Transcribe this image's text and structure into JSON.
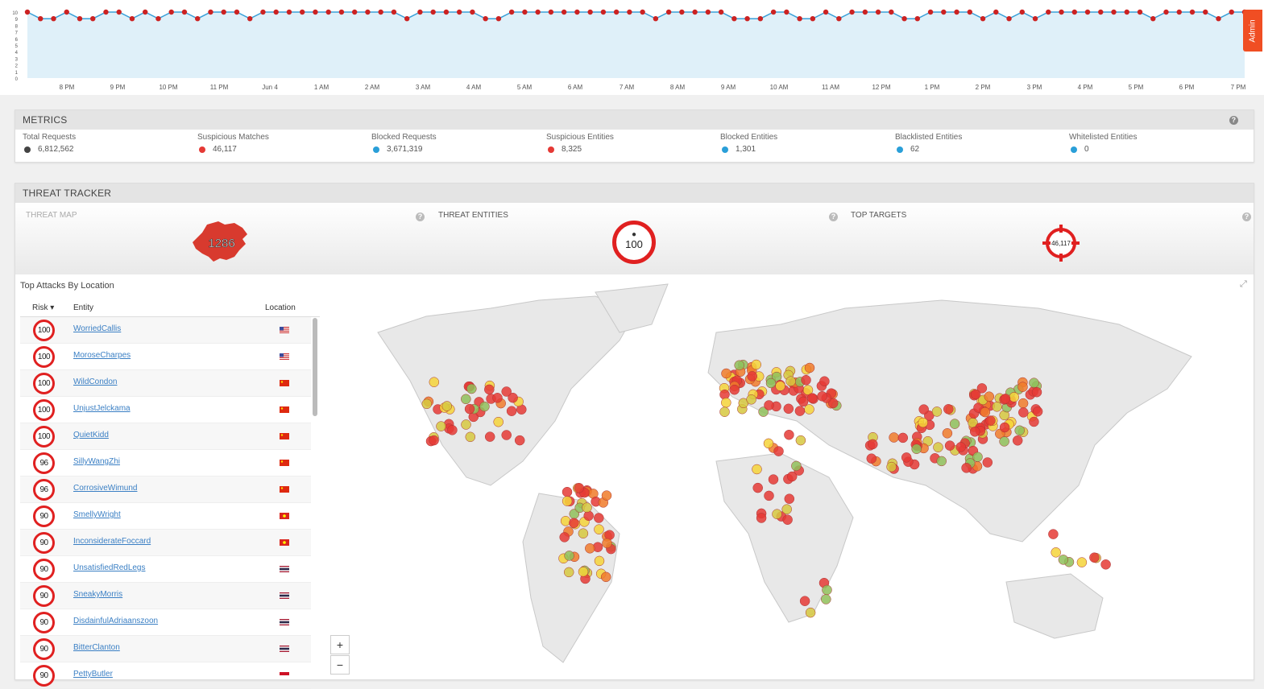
{
  "admin_tab": "Admin",
  "timeline": {
    "y_ticks": [
      "10",
      "9",
      "8",
      "7",
      "6",
      "5",
      "4",
      "3",
      "2",
      "1",
      "0"
    ],
    "x_ticks": [
      "8 PM",
      "9 PM",
      "10 PM",
      "11 PM",
      "Jun 4",
      "1 AM",
      "2 AM",
      "3 AM",
      "4 AM",
      "5 AM",
      "6 AM",
      "7 AM",
      "8 AM",
      "9 AM",
      "10 AM",
      "11 AM",
      "12 PM",
      "1 PM",
      "2 PM",
      "3 PM",
      "4 PM",
      "5 PM",
      "6 PM",
      "7 PM"
    ],
    "values": [
      10,
      9,
      9,
      10,
      9,
      9,
      10,
      10,
      9,
      10,
      9,
      10,
      10,
      9,
      10,
      10,
      10,
      9,
      10,
      10,
      10,
      10,
      10,
      10,
      10,
      10,
      10,
      10,
      10,
      9,
      10,
      10,
      10,
      10,
      10,
      9,
      9,
      10,
      10,
      10,
      10,
      10,
      10,
      10,
      10,
      10,
      10,
      10,
      9,
      10,
      10,
      10,
      10,
      10,
      9,
      9,
      9,
      10,
      10,
      9,
      9,
      10,
      9,
      10,
      10,
      10,
      10,
      9,
      9,
      10,
      10,
      10,
      10,
      9,
      10,
      9,
      10,
      9,
      10,
      10,
      10,
      10,
      10,
      10,
      10,
      10,
      9,
      10,
      10,
      10,
      10,
      9,
      10,
      10
    ],
    "colors": {
      "line": "#3aa0d8",
      "area": "#dff0f9",
      "dot": "#cc2222"
    }
  },
  "metrics": {
    "title": "METRICS",
    "items": [
      {
        "label": "Total Requests",
        "value": "6,812,562",
        "color": "#444444"
      },
      {
        "label": "Suspicious Matches",
        "value": "46,117",
        "color": "#e53935"
      },
      {
        "label": "Blocked Requests",
        "value": "3,671,319",
        "color": "#2a9fd8"
      },
      {
        "label": "Suspicious Entities",
        "value": "8,325",
        "color": "#e53935"
      },
      {
        "label": "Blocked Entities",
        "value": "1,301",
        "color": "#2a9fd8"
      },
      {
        "label": "Blacklisted Entities",
        "value": "62",
        "color": "#2a9fd8"
      },
      {
        "label": "Whitelisted Entities",
        "value": "0",
        "color": "#2a9fd8"
      }
    ]
  },
  "tracker": {
    "title": "THREAT TRACKER",
    "threat_map": {
      "label": "THREAT MAP",
      "value": "1286"
    },
    "threat_entities": {
      "label": "THREAT ENTITIES",
      "value": "100"
    },
    "top_targets": {
      "label": "TOP TARGETS",
      "value": "46,117"
    },
    "list_title": "Top Attacks By Location",
    "columns": {
      "risk": "Risk",
      "entity": "Entity",
      "location": "Location"
    },
    "rows": [
      {
        "risk": "100",
        "entity": "WorriedCallis",
        "flag": "us"
      },
      {
        "risk": "100",
        "entity": "MoroseCharpes",
        "flag": "us"
      },
      {
        "risk": "100",
        "entity": "WildCondon",
        "flag": "cn"
      },
      {
        "risk": "100",
        "entity": "UnjustJelckama",
        "flag": "cn"
      },
      {
        "risk": "100",
        "entity": "QuietKidd",
        "flag": "cn"
      },
      {
        "risk": "96",
        "entity": "SillyWangZhi",
        "flag": "cn"
      },
      {
        "risk": "96",
        "entity": "CorrosiveWimund",
        "flag": "cn"
      },
      {
        "risk": "90",
        "entity": "SmellyWright",
        "flag": "vn"
      },
      {
        "risk": "90",
        "entity": "InconsiderateFoccard",
        "flag": "vn"
      },
      {
        "risk": "90",
        "entity": "UnsatisfiedRedLegs",
        "flag": "th"
      },
      {
        "risk": "90",
        "entity": "SneakyMorris",
        "flag": "th"
      },
      {
        "risk": "90",
        "entity": "DisdainfulAdriaanszoon",
        "flag": "th"
      },
      {
        "risk": "90",
        "entity": "BitterClanton",
        "flag": "th"
      },
      {
        "risk": "90",
        "entity": "PettyButler",
        "flag": "id"
      }
    ],
    "zoom": {
      "in": "+",
      "out": "−"
    }
  }
}
